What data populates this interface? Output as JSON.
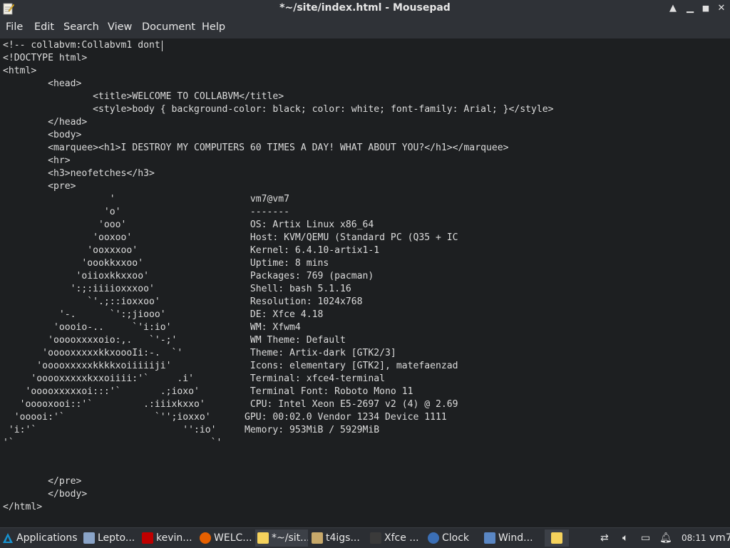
{
  "window": {
    "title": "*~/site/index.html - Mousepad",
    "minimize": "▲",
    "maximize": "◆",
    "close": "✕"
  },
  "menubar": [
    "File",
    "Edit",
    "Search",
    "View",
    "Document",
    "Help"
  ],
  "editor": {
    "lines": [
      "<!-- collabvm:Collabvm1 dont",
      "<!DOCTYPE html>",
      "<html>",
      "\t<head>",
      "\t\t<title>WELCOME TO COLLABVM</title>",
      "\t\t<style>body { background-color: black; color: white; font-family: Arial; }</style>",
      "\t</head>",
      "\t<body>",
      "\t<marquee><h1>I DESTROY MY COMPUTERS 60 TIMES A DAY! WHAT ABOUT YOU?</h1></marquee>",
      "\t<hr>",
      "\t<h3>neofetches</h3>",
      "\t<pre>",
      "                   '                        vm7@vm7",
      "                  'o'                       -------",
      "                 'ooo'                      OS: Artix Linux x86_64",
      "                'ooxoo'                     Host: KVM/QEMU (Standard PC (Q35 + IC",
      "               'ooxxxoo'                    Kernel: 6.4.10-artix1-1",
      "              'oookkxxoo'                   Uptime: 8 mins",
      "             'oiioxkkxxoo'                  Packages: 769 (pacman)",
      "            ':;:iiiioxxxoo'                 Shell: bash 5.1.16",
      "               `'.;::ioxxoo'                Resolution: 1024x768",
      "          '-.      `':;jiooo'               DE: Xfce 4.18",
      "         'oooio-..     `'i:io'              WM: Xfwm4",
      "        'ooooxxxxoio:,.   `'-;'             WM Theme: Default",
      "       'ooooxxxxxkkxoooIi:-.  `'            Theme: Artix-dark [GTK2/3]",
      "      'ooooxxxxxkkkkxoiiiiiji'              Icons: elementary [GTK2], matefaenzad",
      "     'ooooxxxxxkxxoiiii:'`     .i'          Terminal: xfce4-terminal",
      "    'ooooxxxxxoi:::'`       .;ioxo'         Terminal Font: Roboto Mono 11",
      "   'ooooxooi::'`         .:iiixkxxo'        CPU: Intel Xeon E5-2697 v2 (4) @ 2.69",
      "  'ooooi:'`                `'';ioxxo'      GPU: 00:02.0 Vendor 1234 Device 1111",
      " 'i:'`                          '':io'     Memory: 953MiB / 5929MiB",
      "'`                                   `'",
      "",
      "",
      "\t</pre>",
      "\t</body>",
      "</html>"
    ]
  },
  "taskbar": {
    "applications": "Applications",
    "tasks": [
      {
        "label": "Lepto...",
        "icon": "file-manager-icon",
        "color": "#8aa4c8"
      },
      {
        "label": "kevin...",
        "icon": "filezilla-icon",
        "color": "#bf0000"
      },
      {
        "label": "WELC...",
        "icon": "firefox-icon",
        "color": "#e66000"
      },
      {
        "label": "*~/sit...",
        "icon": "text-editor-icon",
        "color": "#f5d25c"
      },
      {
        "label": "t4igs...",
        "icon": "folder-icon",
        "color": "#c8a96a"
      },
      {
        "label": "Xfce ...",
        "icon": "terminal-icon",
        "color": "#3a3a3a"
      },
      {
        "label": "Clock",
        "icon": "clock-icon",
        "color": "#3b6fb6"
      },
      {
        "label": "Wind...",
        "icon": "window-icon",
        "color": "#5a87c4"
      }
    ],
    "clock": "08:11",
    "user": "vm7"
  }
}
